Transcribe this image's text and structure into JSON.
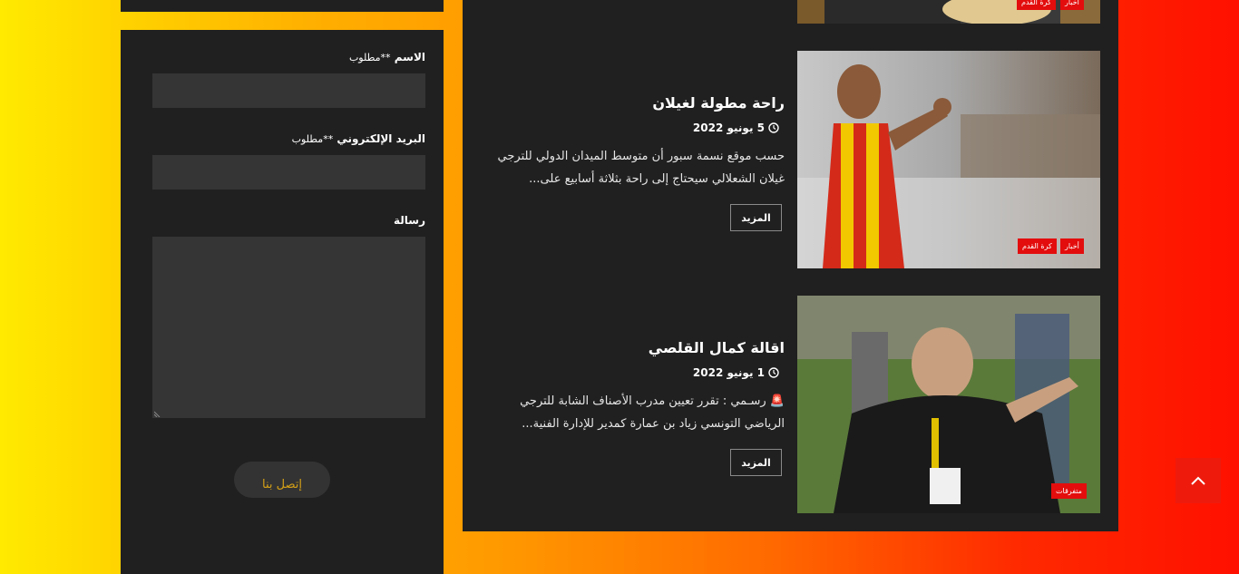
{
  "contact_form": {
    "name_label": "الاسم",
    "email_label": "البريد الإلكتروني",
    "required_suffix": "**مطلوب",
    "message_label": "رسالة",
    "submit_label": "إتصل بنا"
  },
  "posts": [
    {
      "tags": [
        "أخبار",
        "كرة القدم"
      ]
    },
    {
      "title": "راحة مطولة لغيلان",
      "date": "5 يونيو 2022",
      "excerpt": "حسب موقع نسمة سبور أن متوسط الميدان الدولي للترجي غيلان الشعلالي سيحتاج إلى راحة بثلاثة أسابيع على...",
      "more_label": "المزيد",
      "tags": [
        "أخبار",
        "كرة القدم"
      ]
    },
    {
      "title": "اقالة كمال القلصي",
      "date": "1 يونيو 2022",
      "excerpt": "🚨 رسـمي : تقرر تعيين مدرب الأصناف الشابة للترجي الرياضي التونسي زياد بن عمارة كمدير للإدارة الفنية...",
      "more_label": "المزيد",
      "tags": [
        "متفرقات"
      ]
    }
  ],
  "colors": {
    "panel_bg": "#202020",
    "input_bg": "#353535",
    "tag_red": "#e30d0d",
    "accent_gold": "#d4a017",
    "scroll_btn": "#ee1b0d"
  },
  "icons": {
    "date": "clock-icon",
    "scroll_top": "chevron-up-icon"
  }
}
